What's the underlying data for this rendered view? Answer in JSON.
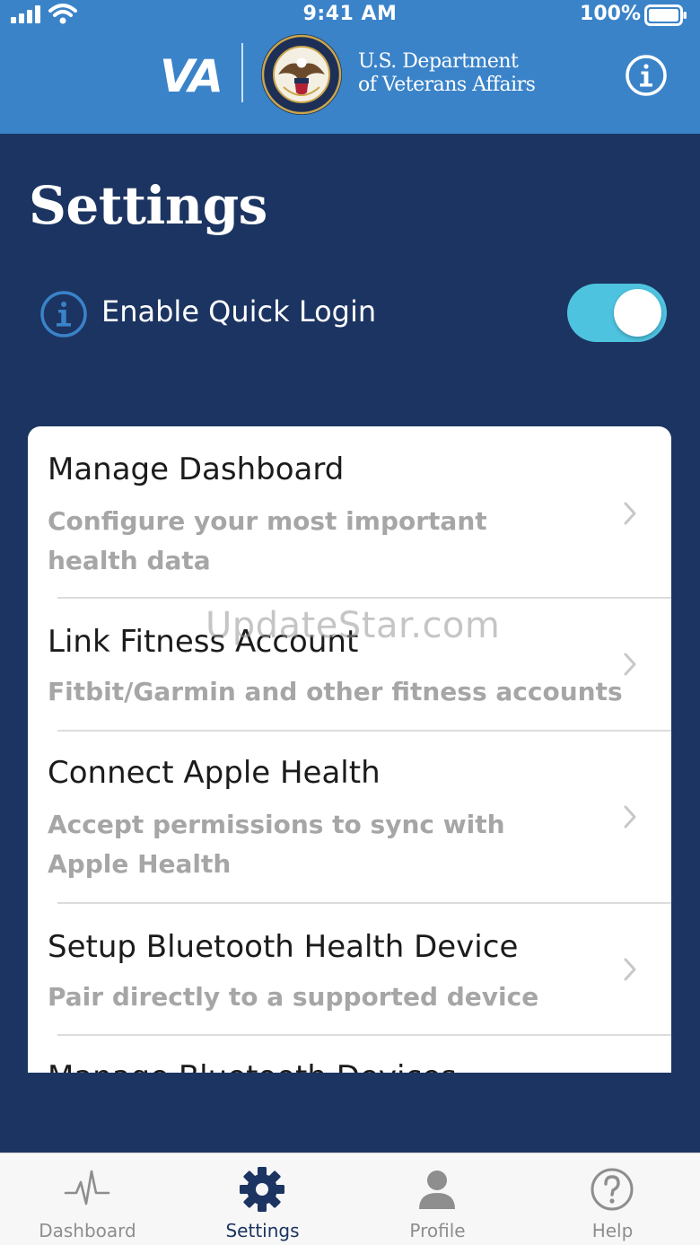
{
  "status_bar": {
    "time": "9:41 AM",
    "battery": "100%"
  },
  "header": {
    "logo_text": "VA",
    "department_line1": "U.S. Department",
    "department_line2": "of Veterans Affairs",
    "seal_ring_text": "DEPARTMENT OF VETERANS AFFAIRS · UNITED STATES OF AMERICA"
  },
  "page": {
    "title": "Settings"
  },
  "quick_login": {
    "label": "Enable Quick Login",
    "enabled": true
  },
  "menu": {
    "items": [
      {
        "title": "Manage Dashboard",
        "desc_line1": "Configure your most important",
        "desc_line2": "health data"
      },
      {
        "title": "Link Fitness Account",
        "desc_line1": "Fitbit/Garmin and other fitness accounts"
      },
      {
        "title": "Connect Apple Health",
        "desc_line1": "Accept permissions to sync with",
        "desc_line2": "Apple Health"
      },
      {
        "title": "Setup Bluetooth Health Device",
        "desc_line1": "Pair directly to a supported device"
      },
      {
        "title": "Manage Bluetooth Devices"
      }
    ]
  },
  "watermark": "UpdateStar.com",
  "tab_bar": {
    "tabs": [
      {
        "label": "Dashboard",
        "icon": "pulse-icon"
      },
      {
        "label": "Settings",
        "icon": "gear-icon",
        "active": true
      },
      {
        "label": "Profile",
        "icon": "person-icon"
      },
      {
        "label": "Help",
        "icon": "question-circle-icon"
      }
    ]
  },
  "colors": {
    "header_blue": "#3a83c9",
    "background_navy": "#1c3461",
    "toggle_on": "#4ec3e0",
    "info_icon_blue": "#3a83c9"
  }
}
